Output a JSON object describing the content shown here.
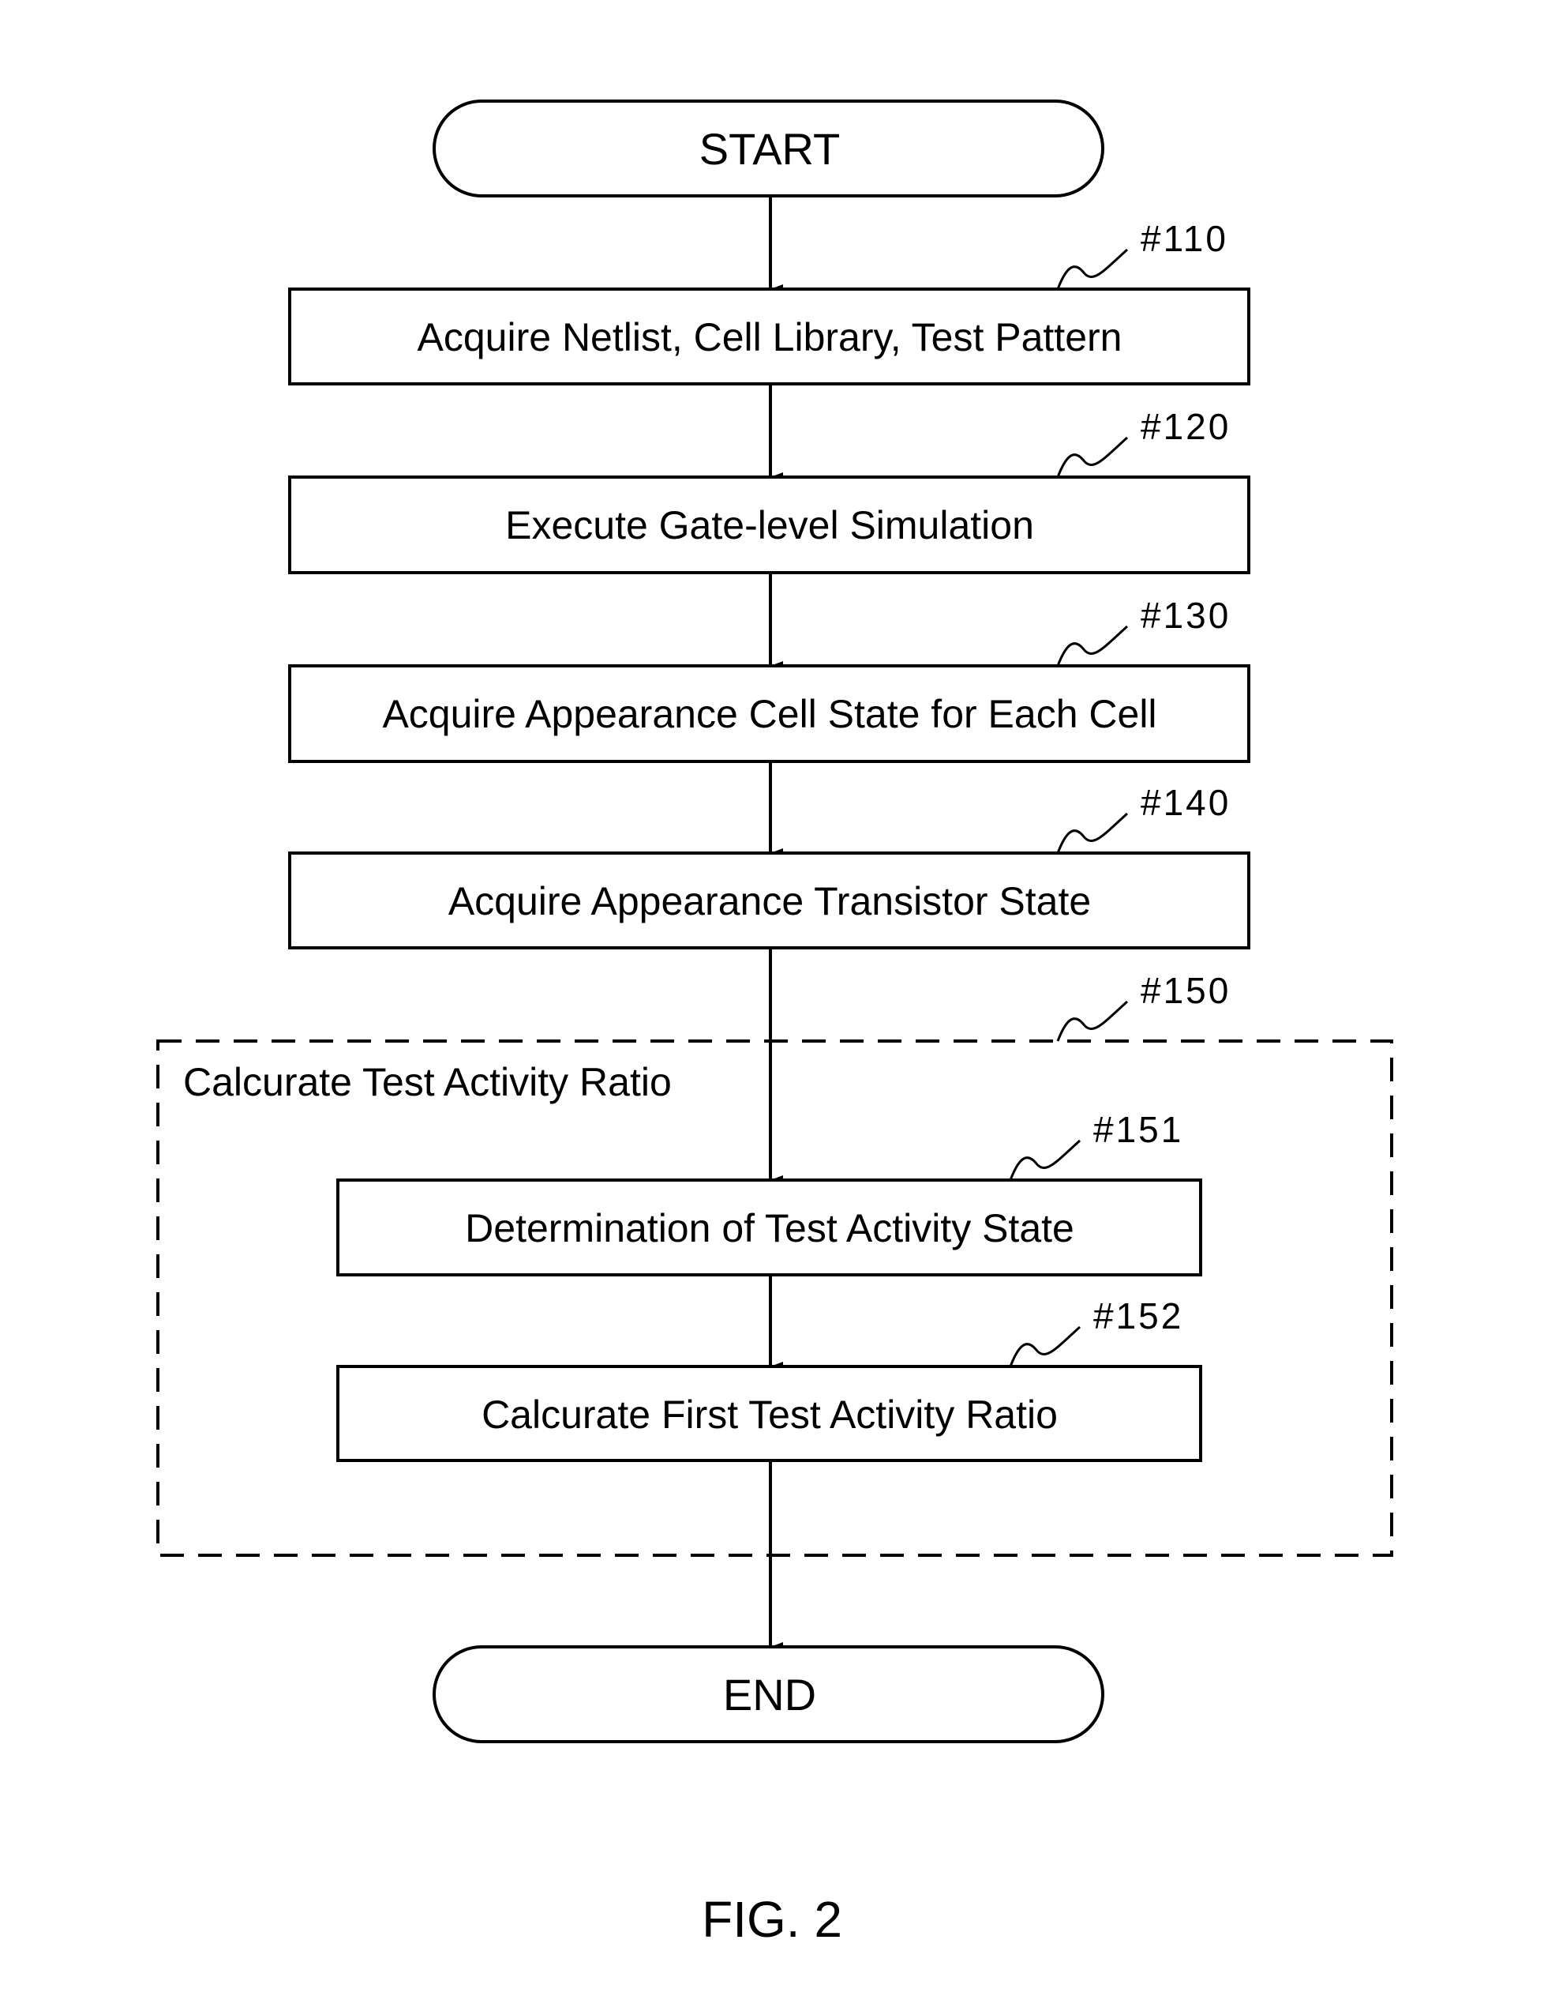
{
  "diagram": {
    "type": "flowchart",
    "start": {
      "label": "START"
    },
    "end": {
      "label": "END"
    },
    "steps": [
      {
        "id": "#110",
        "label": "Acquire Netlist, Cell Library, Test Pattern"
      },
      {
        "id": "#120",
        "label": "Execute Gate-level Simulation"
      },
      {
        "id": "#130",
        "label": "Acquire Appearance Cell State for Each Cell"
      },
      {
        "id": "#140",
        "label": "Acquire Appearance Transistor State"
      }
    ],
    "group": {
      "id": "#150",
      "label": "Calcurate Test Activity Ratio",
      "steps": [
        {
          "id": "#151",
          "label": "Determination of Test Activity State"
        },
        {
          "id": "#152",
          "label": "Calcurate First Test Activity Ratio"
        }
      ]
    },
    "edges": [
      [
        "START",
        "#110"
      ],
      [
        "#110",
        "#120"
      ],
      [
        "#120",
        "#130"
      ],
      [
        "#130",
        "#140"
      ],
      [
        "#140",
        "#151"
      ],
      [
        "#151",
        "#152"
      ],
      [
        "#152",
        "END"
      ]
    ],
    "caption": "FIG. 2"
  }
}
